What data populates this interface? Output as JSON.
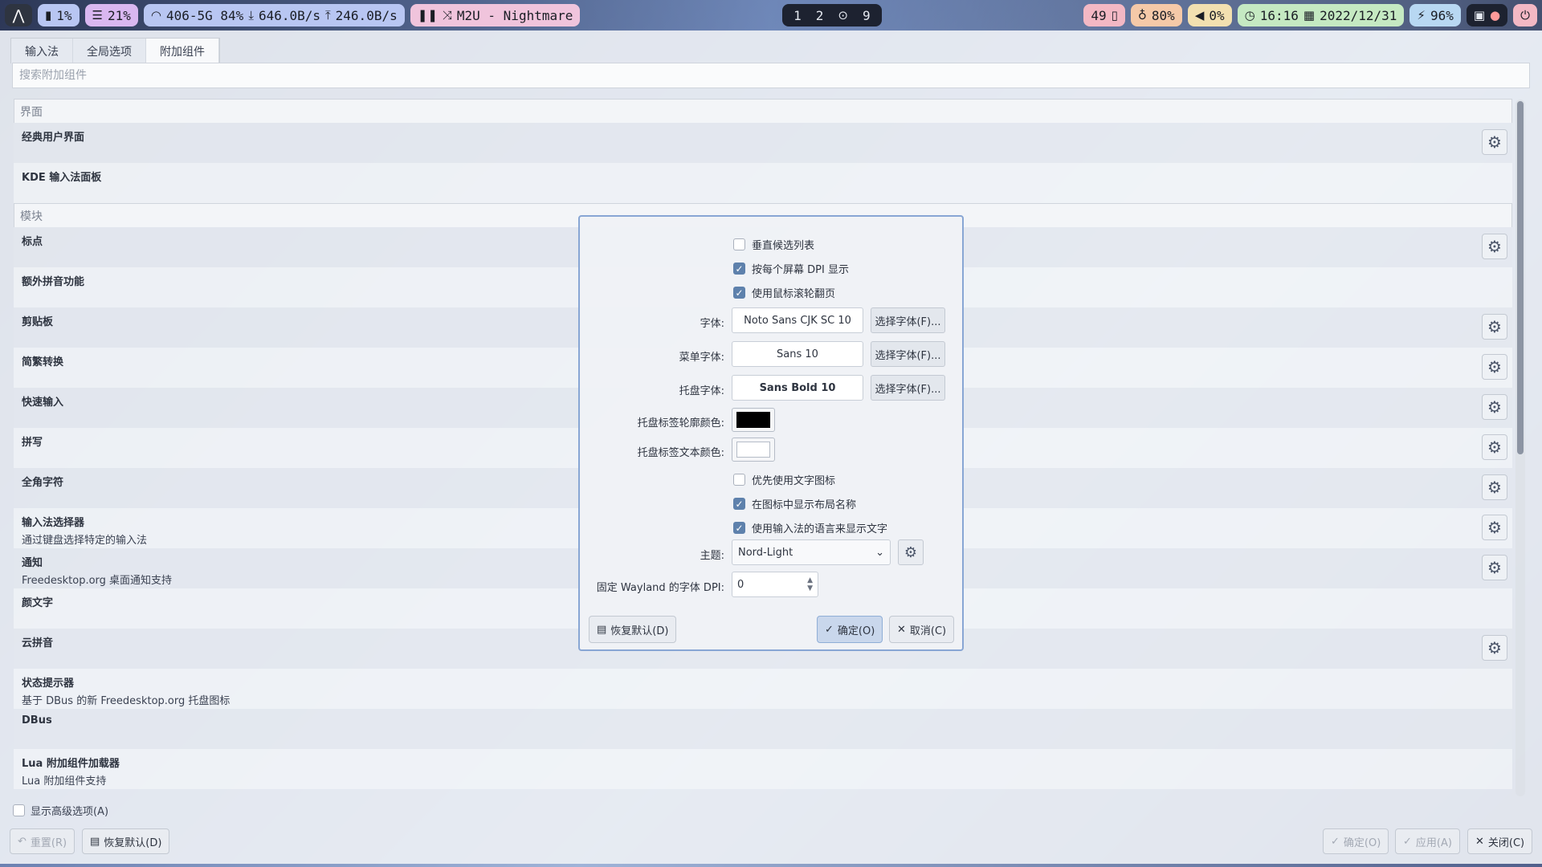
{
  "topbar": {
    "cpu": "1%",
    "mem": "21%",
    "net": "406-5G 84%",
    "down": "646.0B/s",
    "up": "246.0B/s",
    "media": "M2U - Nightmare",
    "workspaces": [
      "1",
      "2",
      "9"
    ],
    "notifications": "49",
    "brightness": "80%",
    "volume": "0%",
    "time": "16:16",
    "date": "2022/12/31",
    "battery": "96%"
  },
  "tabs": [
    "输入法",
    "全局选项",
    "附加组件"
  ],
  "search_placeholder": "搜索附加组件",
  "categories": {
    "ui": "界面",
    "modules": "模块"
  },
  "ui_items": [
    {
      "title": "经典用户界面",
      "desc": "",
      "gear": true
    },
    {
      "title": "KDE 输入法面板",
      "desc": "",
      "gear": false
    }
  ],
  "module_items": [
    {
      "title": "标点",
      "desc": "",
      "gear": true
    },
    {
      "title": "额外拼音功能",
      "desc": "",
      "gear": false
    },
    {
      "title": "剪贴板",
      "desc": "",
      "gear": true
    },
    {
      "title": "简繁转换",
      "desc": "",
      "gear": true
    },
    {
      "title": "快速输入",
      "desc": "",
      "gear": true
    },
    {
      "title": "拼写",
      "desc": "",
      "gear": true
    },
    {
      "title": "全角字符",
      "desc": "",
      "gear": true
    },
    {
      "title": "输入法选择器",
      "desc": "通过键盘选择特定的输入法",
      "gear": true
    },
    {
      "title": "通知",
      "desc": "Freedesktop.org 桌面通知支持",
      "gear": true
    },
    {
      "title": "颜文字",
      "desc": "",
      "gear": false
    },
    {
      "title": "云拼音",
      "desc": "",
      "gear": true
    },
    {
      "title": "状态提示器",
      "desc": "基于 DBus 的新 Freedesktop.org 托盘图标",
      "gear": false
    },
    {
      "title": "DBus",
      "desc": "",
      "gear": false
    },
    {
      "title": "Lua 附加组件加载器",
      "desc": "Lua 附加组件支持",
      "gear": false
    }
  ],
  "advanced_label": "显示高级选项(A)",
  "bottom_buttons": {
    "reset": "重置(R)",
    "defaults": "恢复默认(D)",
    "ok": "确定(O)",
    "apply": "应用(A)",
    "close": "关闭(C)"
  },
  "dialog": {
    "vertical_list": "垂直候选列表",
    "per_screen_dpi": "按每个屏幕 DPI 显示",
    "wheel_page": "使用鼠标滚轮翻页",
    "font_label": "字体:",
    "font_value": "Noto Sans CJK SC 10",
    "menu_font_label": "菜单字体:",
    "menu_font_value": "Sans 10",
    "tray_font_label": "托盘字体:",
    "tray_font_value": "Sans Bold 10",
    "choose_font": "选择字体(F)...",
    "outline_color_label": "托盘标签轮廓颜色:",
    "text_color_label": "托盘标签文本颜色:",
    "outline_color": "#000000",
    "text_color": "#ffffff",
    "prefer_text_icon": "优先使用文字图标",
    "show_layout_name": "在图标中显示布局名称",
    "use_im_language": "使用输入法的语言来显示文字",
    "theme_label": "主题:",
    "theme_value": "Nord-Light",
    "wayland_dpi_label": "固定 Wayland 的字体 DPI:",
    "wayland_dpi_value": "0",
    "restore_defaults": "恢复默认(D)",
    "ok": "确定(O)",
    "cancel": "取消(C)"
  }
}
